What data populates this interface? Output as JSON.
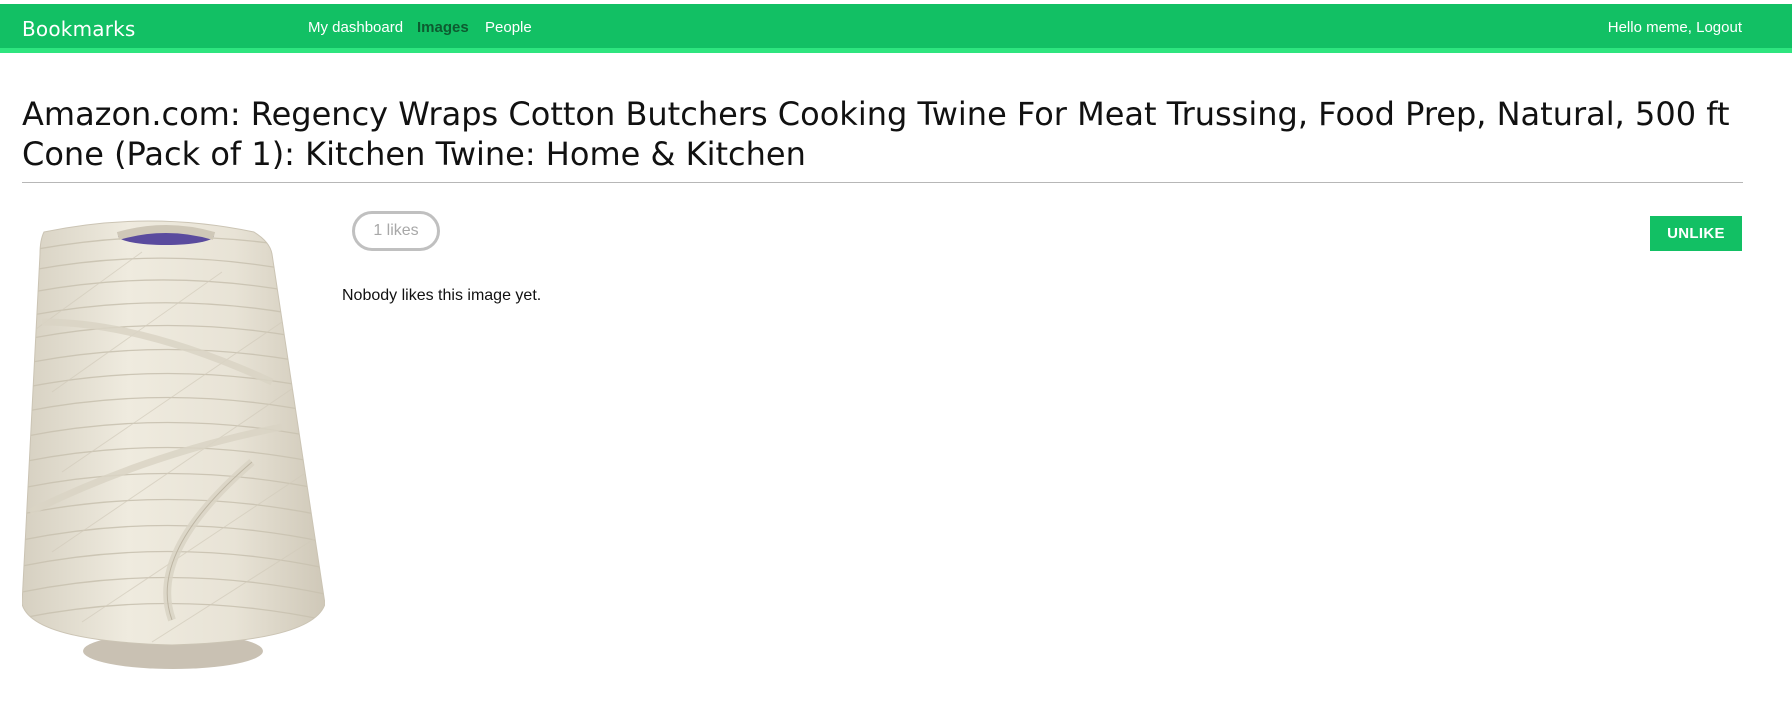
{
  "header": {
    "logo": "Bookmarks",
    "nav": [
      {
        "label": "My dashboard",
        "active": false
      },
      {
        "label": "Images",
        "active": true
      },
      {
        "label": "People",
        "active": false
      }
    ],
    "user_greeting": "Hello meme, Logout"
  },
  "image": {
    "title": "Amazon.com: Regency Wraps Cotton Butchers Cooking Twine For Meat Trussing, Food Prep, Natural, 500 ft Cone (Pack of 1): Kitchen Twine: Home & Kitchen",
    "likes_label": "1 likes",
    "unlike_label": "UNLIKE",
    "likers_empty": "Nobody likes this image yet."
  },
  "colors": {
    "brand_green": "#12c064",
    "active_nav": "#0d5b30"
  }
}
